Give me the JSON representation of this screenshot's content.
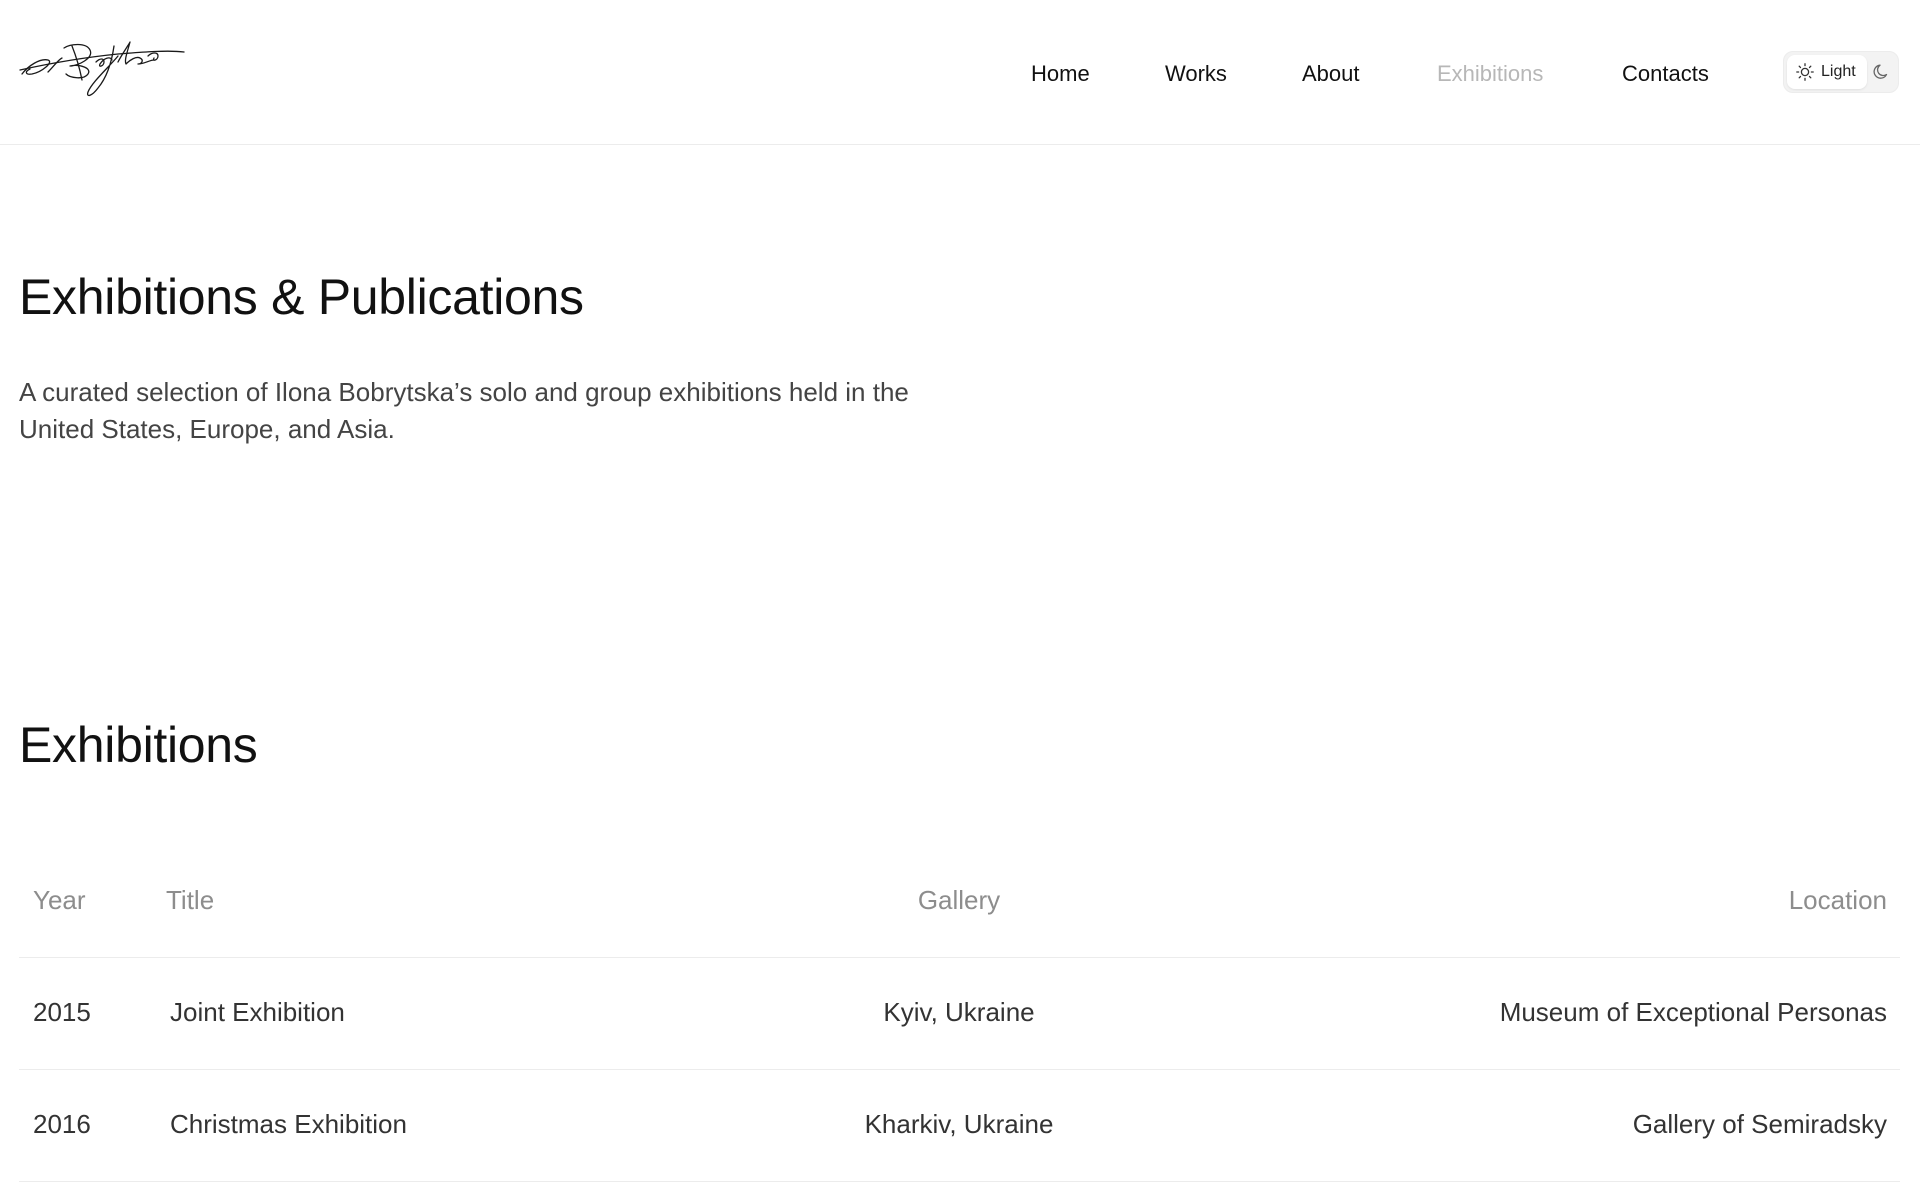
{
  "header": {
    "logo": "signature-logo",
    "nav": [
      {
        "label": "Home",
        "active": false
      },
      {
        "label": "Works",
        "active": false
      },
      {
        "label": "About",
        "active": false
      },
      {
        "label": "Exhibitions",
        "active": true
      },
      {
        "label": "Contacts",
        "active": false
      }
    ],
    "theme_toggle": {
      "light_label": "Light",
      "light_icon": "sun-icon",
      "dark_icon": "moon-icon"
    }
  },
  "main": {
    "title": "Exhibitions & Publications",
    "intro": "A curated selection of Ilona Bobrytska’s solo and group exhibitions held in the United States, Europe, and Asia.",
    "exhibitions": {
      "title": "Exhibitions",
      "columns": [
        "Year",
        "Title",
        "Gallery",
        "Location"
      ],
      "rows": [
        {
          "year": "2015",
          "title": "Joint Exhibition",
          "gallery": "Kyiv, Ukraine",
          "location": "Museum of Exceptional Personas"
        },
        {
          "year": "2016",
          "title": "Christmas Exhibition",
          "gallery": "Kharkiv, Ukraine",
          "location": "Gallery of Semiradsky"
        }
      ]
    }
  },
  "colors": {
    "text": "#111111",
    "muted": "#8d8d8d",
    "active_nav": "#b7b7b7",
    "divider": "#ececec",
    "background": "#ffffff"
  }
}
